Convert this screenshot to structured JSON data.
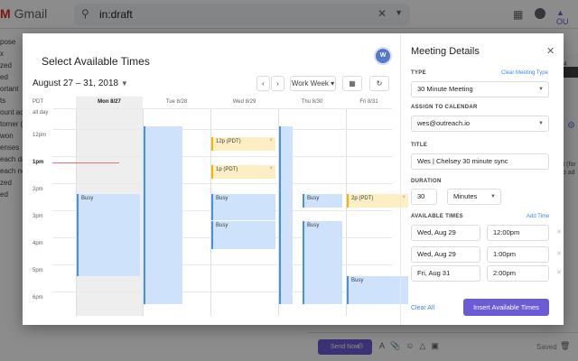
{
  "gmail": {
    "logo": "Gmail",
    "search_query": "in:draft",
    "sidebar_items": [
      "pose",
      "",
      "x",
      "zed",
      "ed",
      "ortant",
      "",
      "ts",
      "ount acc",
      "tomer (",
      "won",
      "enses",
      "each da",
      "each ne",
      "zed",
      "ed"
    ],
    "right_time": "1:04",
    "right_text": [
      "pact (for",
      "ail to ad"
    ],
    "send_label": "Send Now",
    "saved_label": "Saved"
  },
  "calendar": {
    "title": "Select Available Times",
    "avatar_initial": "W",
    "date_range": "August 27 – 31, 2018",
    "view": "Work Week",
    "timezone": "PDT",
    "allday_label": "all day",
    "days": [
      "Mon 8/27",
      "Tue 8/28",
      "Wed 8/29",
      "Thu 8/30",
      "Fri 8/31"
    ],
    "times": [
      "12pm",
      "1pm",
      "2pm",
      "3pm",
      "4pm",
      "5pm",
      "6pm"
    ],
    "busy_label": "Busy",
    "slot_labels": {
      "wed_12": "12p (PDT)",
      "wed_1": "1p (PDT)",
      "fri_2": "2p (PDT)"
    }
  },
  "details": {
    "title": "Meeting Details",
    "type_label": "TYPE",
    "clear_type": "Clear Meeting Type",
    "type_value": "30 Minute Meeting",
    "assign_label": "ASSIGN TO CALENDAR",
    "assign_value": "wes@outreach.io",
    "title_label": "TITLE",
    "title_value": "Wes | Chelsey 30 minute sync",
    "duration_label": "DURATION",
    "duration_value": "30",
    "duration_unit": "Minutes",
    "avail_label": "AVAILABLE TIMES",
    "add_time": "Add Time",
    "slots": [
      {
        "date": "Wed, Aug 29",
        "time": "12:00pm"
      },
      {
        "date": "Wed, Aug 29",
        "time": "1:00pm"
      },
      {
        "date": "Fri, Aug 31",
        "time": "2:00pm"
      }
    ],
    "clear_all": "Clear All",
    "insert_label": "Insert Available Times"
  },
  "colors": {
    "accent": "#6b5bd6",
    "busy": "#cfe2fb",
    "slot": "#fdefc3",
    "now_line": "#e57373"
  }
}
